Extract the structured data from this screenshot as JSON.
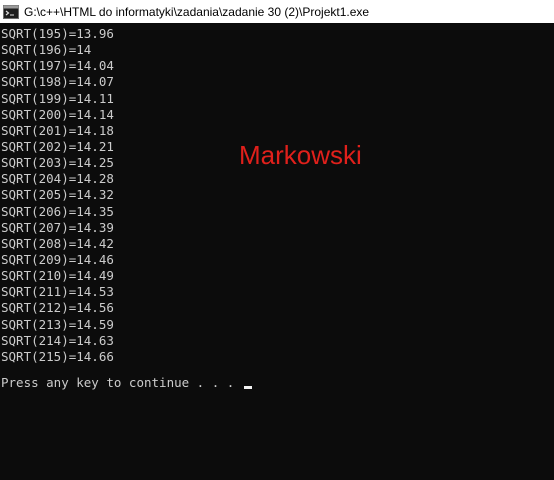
{
  "window": {
    "title": "G:\\c++\\HTML do informatyki\\zadania\\zadanie 30 (2)\\Projekt1.exe",
    "icon": "console-app-icon"
  },
  "console": {
    "lines": [
      "SQRT(195)=13.96",
      "SQRT(196)=14",
      "SQRT(197)=14.04",
      "SQRT(198)=14.07",
      "SQRT(199)=14.11",
      "SQRT(200)=14.14",
      "SQRT(201)=14.18",
      "SQRT(202)=14.21",
      "SQRT(203)=14.25",
      "SQRT(204)=14.28",
      "SQRT(205)=14.32",
      "SQRT(206)=14.35",
      "SQRT(207)=14.39",
      "SQRT(208)=14.42",
      "SQRT(209)=14.46",
      "SQRT(210)=14.49",
      "SQRT(211)=14.53",
      "SQRT(212)=14.56",
      "SQRT(213)=14.59",
      "SQRT(214)=14.63",
      "SQRT(215)=14.66"
    ],
    "prompt": "Press any key to continue . . . ",
    "text_color": "#cccccc",
    "background_color": "#0c0c0c"
  },
  "watermark": {
    "text": "Markowski",
    "color": "#e0201b"
  }
}
